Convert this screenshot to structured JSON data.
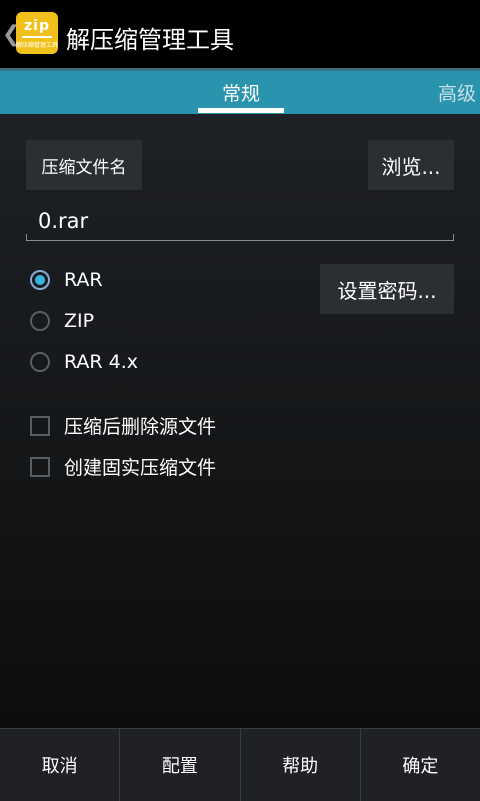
{
  "actionbar": {
    "back_glyph": "❮",
    "icon": {
      "name": "zip-app-icon",
      "text": "zip",
      "sub": "解压缩管理工具"
    },
    "title": "解压缩管理工具"
  },
  "tabs": {
    "general": "常规",
    "advanced": "高级"
  },
  "form": {
    "filename_button": "压缩文件名",
    "browse_button": "浏览...",
    "filename_value": "0.rar",
    "password_button": "设置密码...",
    "formats": [
      {
        "label": "RAR",
        "checked": true
      },
      {
        "label": "ZIP",
        "checked": false
      },
      {
        "label": "RAR 4.x",
        "checked": false
      }
    ],
    "options": [
      {
        "label": "压缩后删除源文件",
        "checked": false
      },
      {
        "label": "创建固实压缩文件",
        "checked": false
      }
    ]
  },
  "bottombar": {
    "cancel": "取消",
    "config": "配置",
    "help": "帮助",
    "ok": "确定"
  },
  "colors": {
    "tab_bar": "#2a93ae",
    "radio_accent": "#35b5e5",
    "icon_bg": "#f2c01a"
  }
}
